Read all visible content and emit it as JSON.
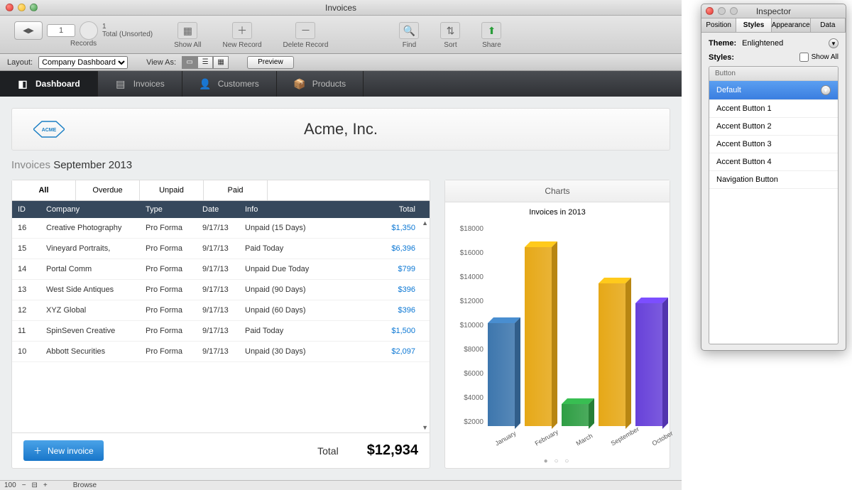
{
  "window": {
    "title": "Invoices"
  },
  "toolbar": {
    "record_number": "1",
    "record_count": "1",
    "record_sort": "Total (Unsorted)",
    "records_label": "Records",
    "show_all": "Show All",
    "new_record": "New Record",
    "delete_record": "Delete Record",
    "find": "Find",
    "sort": "Sort",
    "share": "Share"
  },
  "layoutbar": {
    "layout_label": "Layout:",
    "layout_value": "Company Dashboard",
    "viewas_label": "View As:",
    "preview": "Preview"
  },
  "nav": {
    "items": [
      {
        "label": "Dashboard",
        "icon": "dashboard-icon",
        "active": true
      },
      {
        "label": "Invoices",
        "icon": "list-icon",
        "active": false
      },
      {
        "label": "Customers",
        "icon": "person-icon",
        "active": false
      },
      {
        "label": "Products",
        "icon": "box-icon",
        "active": false
      }
    ]
  },
  "company": {
    "name": "Acme, Inc."
  },
  "section": {
    "prefix": "Invoices",
    "period": "September 2013"
  },
  "invoice_tabs": [
    "All",
    "Overdue",
    "Unpaid",
    "Paid"
  ],
  "invoice_tabs_active": 0,
  "table": {
    "headers": {
      "id": "ID",
      "company": "Company",
      "type": "Type",
      "date": "Date",
      "info": "Info",
      "total": "Total"
    },
    "rows": [
      {
        "id": "16",
        "company": "Creative Photography",
        "type": "Pro Forma",
        "date": "9/17/13",
        "info": "Unpaid (15 Days)",
        "total": "$1,350"
      },
      {
        "id": "15",
        "company": "Vineyard Portraits,",
        "type": "Pro Forma",
        "date": "9/17/13",
        "info": "Paid Today",
        "total": "$6,396"
      },
      {
        "id": "14",
        "company": "Portal Comm",
        "type": "Pro Forma",
        "date": "9/17/13",
        "info": "Unpaid Due Today",
        "total": "$799"
      },
      {
        "id": "13",
        "company": "West Side Antiques",
        "type": "Pro Forma",
        "date": "9/17/13",
        "info": "Unpaid (90 Days)",
        "total": "$396"
      },
      {
        "id": "12",
        "company": "XYZ Global",
        "type": "Pro Forma",
        "date": "9/17/13",
        "info": "Unpaid (60 Days)",
        "total": "$396"
      },
      {
        "id": "11",
        "company": "SpinSeven Creative",
        "type": "Pro Forma",
        "date": "9/17/13",
        "info": "Paid Today",
        "total": "$1,500"
      },
      {
        "id": "10",
        "company": "Abbott Securities",
        "type": "Pro Forma",
        "date": "9/17/13",
        "info": "Unpaid (30 Days)",
        "total": "$2,097"
      }
    ],
    "footer": {
      "new_invoice": "New invoice",
      "total_label": "Total",
      "total_value": "$12,934"
    }
  },
  "charts_panel": {
    "heading": "Charts",
    "title": "Invoices in 2013"
  },
  "chart_data": {
    "type": "bar",
    "title": "Invoices in 2013",
    "xlabel": "",
    "ylabel": "",
    "ylim": [
      0,
      18000
    ],
    "yticks": [
      "$18000",
      "$16000",
      "$14000",
      "$12000",
      "$10000",
      "$8000",
      "$6000",
      "$4000",
      "$2000"
    ],
    "categories": [
      "January",
      "February",
      "March",
      "September",
      "October"
    ],
    "values": [
      9200,
      16000,
      2000,
      12800,
      11000
    ],
    "colors": [
      "#3d76ad",
      "#e6a817",
      "#2f9e44",
      "#e6a817",
      "#6741d9"
    ]
  },
  "statusbar": {
    "zoom": "100",
    "mode": "Browse"
  },
  "inspector": {
    "title": "Inspector",
    "tabs": [
      "Position",
      "Styles",
      "Appearance",
      "Data"
    ],
    "active_tab": 1,
    "theme_label": "Theme:",
    "theme_value": "Enlightened",
    "styles_label": "Styles:",
    "showall_label": "Show All",
    "group_header": "Button",
    "items": [
      "Default",
      "Accent Button 1",
      "Accent Button 2",
      "Accent Button 3",
      "Accent Button 4",
      "Navigation Button"
    ],
    "selected_index": 0
  }
}
